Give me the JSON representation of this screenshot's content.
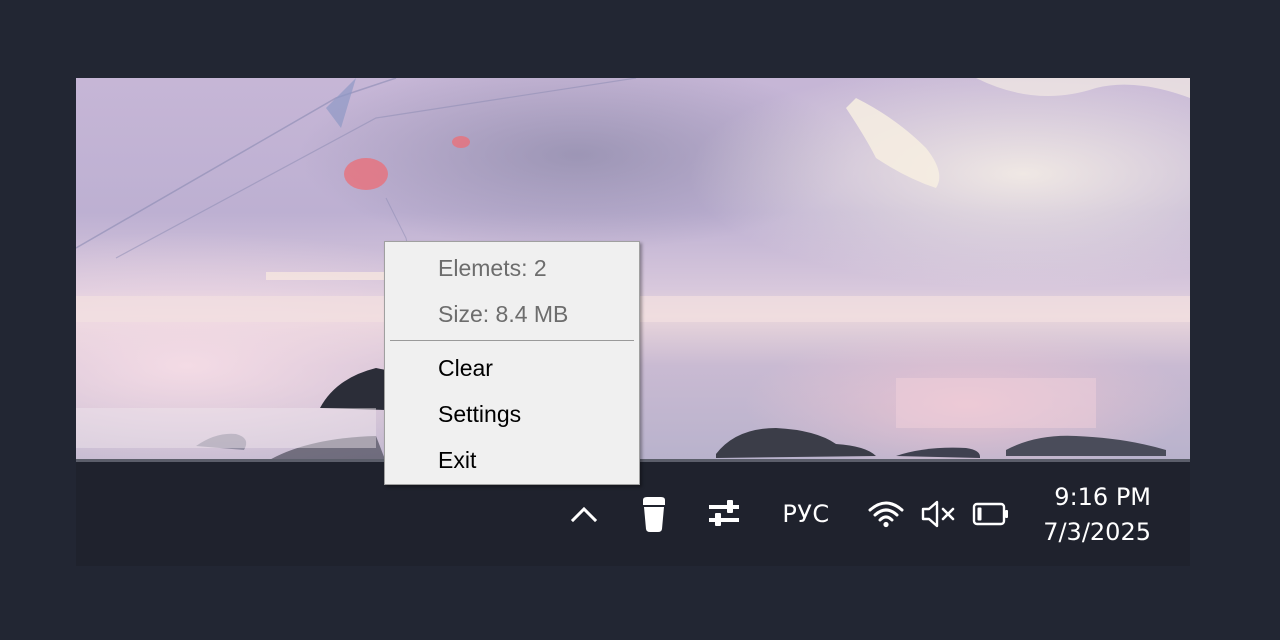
{
  "context_menu": {
    "info_elements": "Elemets: 2",
    "info_size": "Size: 8.4 MB",
    "items": [
      {
        "label": "Clear"
      },
      {
        "label": "Settings"
      },
      {
        "label": "Exit"
      }
    ]
  },
  "taskbar": {
    "language": "РУС",
    "time": "9:16 PM",
    "date": "7/3/2025",
    "icons": [
      "chevron-up-icon",
      "trash-bin-icon",
      "sliders-icon",
      "wifi-icon",
      "volume-muted-icon",
      "battery-icon"
    ]
  },
  "colors": {
    "background": "#222633",
    "taskbar": "#1f222d",
    "menu_background": "#f0f0f0",
    "menu_disabled_text": "#6d6d6d"
  }
}
